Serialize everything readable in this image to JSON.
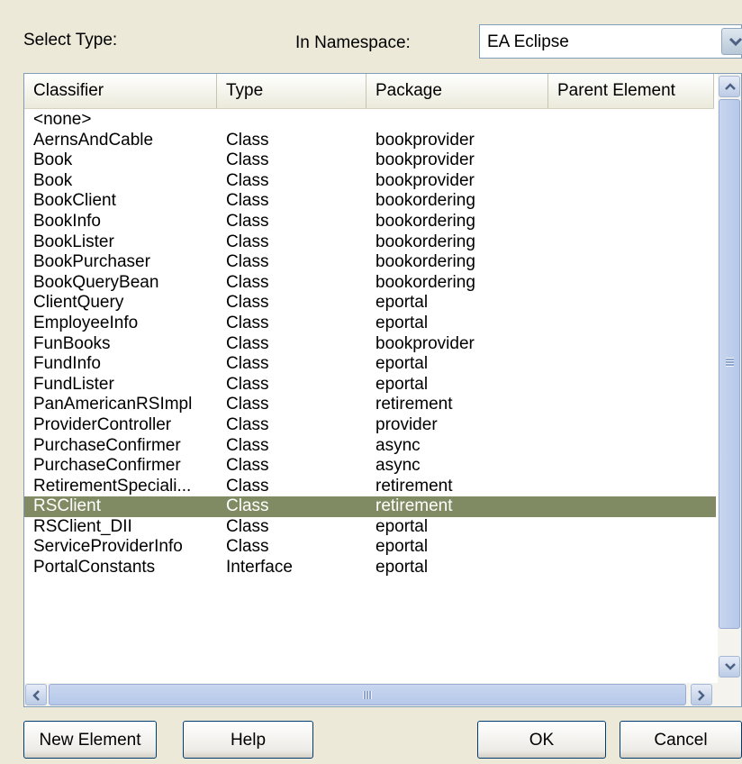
{
  "dialog": {
    "select_type_label": "Select Type:",
    "namespace_label": "In Namespace:",
    "namespace_value": "EA Eclipse"
  },
  "columns": [
    "Classifier",
    "Type",
    "Package",
    "Parent Element"
  ],
  "rows": [
    {
      "classifier": "<none>",
      "type": "",
      "package": "",
      "parent": ""
    },
    {
      "classifier": "AernsAndCable",
      "type": "Class",
      "package": "bookprovider",
      "parent": ""
    },
    {
      "classifier": "Book",
      "type": "Class",
      "package": "bookprovider",
      "parent": ""
    },
    {
      "classifier": "Book",
      "type": "Class",
      "package": "bookprovider",
      "parent": ""
    },
    {
      "classifier": "BookClient",
      "type": "Class",
      "package": "bookordering",
      "parent": ""
    },
    {
      "classifier": "BookInfo",
      "type": "Class",
      "package": "bookordering",
      "parent": ""
    },
    {
      "classifier": "BookLister",
      "type": "Class",
      "package": "bookordering",
      "parent": ""
    },
    {
      "classifier": "BookPurchaser",
      "type": "Class",
      "package": "bookordering",
      "parent": ""
    },
    {
      "classifier": "BookQueryBean",
      "type": "Class",
      "package": "bookordering",
      "parent": ""
    },
    {
      "classifier": "ClientQuery",
      "type": "Class",
      "package": "eportal",
      "parent": ""
    },
    {
      "classifier": "EmployeeInfo",
      "type": "Class",
      "package": "eportal",
      "parent": ""
    },
    {
      "classifier": "FunBooks",
      "type": "Class",
      "package": "bookprovider",
      "parent": ""
    },
    {
      "classifier": "FundInfo",
      "type": "Class",
      "package": "eportal",
      "parent": ""
    },
    {
      "classifier": "FundLister",
      "type": "Class",
      "package": "eportal",
      "parent": ""
    },
    {
      "classifier": "PanAmericanRSImpl",
      "type": "Class",
      "package": "retirement",
      "parent": ""
    },
    {
      "classifier": "ProviderController",
      "type": "Class",
      "package": "provider",
      "parent": ""
    },
    {
      "classifier": "PurchaseConfirmer",
      "type": "Class",
      "package": "async",
      "parent": ""
    },
    {
      "classifier": "PurchaseConfirmer",
      "type": "Class",
      "package": "async",
      "parent": ""
    },
    {
      "classifier": "RetirementSpeciali...",
      "type": "Class",
      "package": "retirement",
      "parent": ""
    },
    {
      "classifier": "RSClient",
      "type": "Class",
      "package": "retirement",
      "parent": "",
      "selected": true
    },
    {
      "classifier": "RSClient_DII",
      "type": "Class",
      "package": "eportal",
      "parent": ""
    },
    {
      "classifier": "ServiceProviderInfo",
      "type": "Class",
      "package": "eportal",
      "parent": ""
    },
    {
      "classifier": "PortalConstants",
      "type": "Interface",
      "package": "eportal",
      "parent": ""
    }
  ],
  "buttons": {
    "new_element": "New Element",
    "help": "Help",
    "ok": "OK",
    "cancel": "Cancel"
  },
  "colors": {
    "selection": "#808b63",
    "dialog_bg": "#ece9d8"
  },
  "icons": {
    "namespace_dropdown": "chevron-down-icon",
    "scroll_up": "arrow-up-icon",
    "scroll_down": "arrow-down-icon",
    "scroll_left": "arrow-left-icon",
    "scroll_right": "arrow-right-icon"
  }
}
